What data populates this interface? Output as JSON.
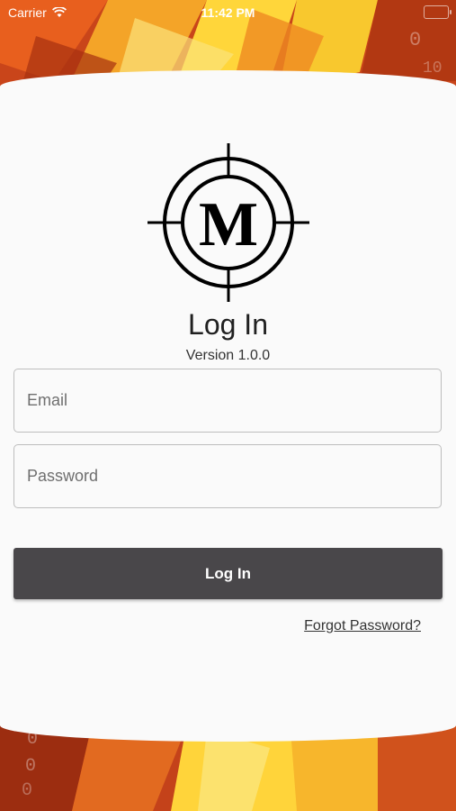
{
  "status_bar": {
    "carrier": "Carrier",
    "time": "11:42 PM"
  },
  "logo": {
    "letter": "M",
    "icon": "crosshair-m-logo"
  },
  "header": {
    "title": "Log In",
    "version": "Version 1.0.0"
  },
  "form": {
    "email_placeholder": "Email",
    "password_placeholder": "Password",
    "login_label": "Log In",
    "forgot_label": "Forgot Password?"
  },
  "colors": {
    "button": "#49474a",
    "card": "#fafafa",
    "accent_orange": "#e0621d",
    "accent_yellow": "#f6c02a"
  }
}
